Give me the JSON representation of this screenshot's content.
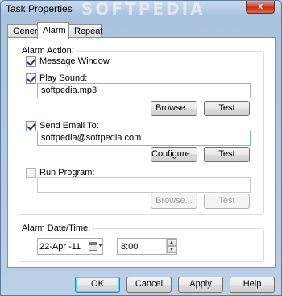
{
  "window": {
    "title": "Task Properties",
    "watermark": "SOFTPEDIA",
    "close_glyph": "x"
  },
  "tabs": [
    {
      "label": "General",
      "active": false
    },
    {
      "label": "Alarm",
      "active": true
    },
    {
      "label": "Repeat",
      "active": false
    }
  ],
  "alarm_action": {
    "group_title": "Alarm Action:",
    "message_window": {
      "label": "Message Window",
      "checked": true
    },
    "play_sound": {
      "label": "Play Sound:",
      "checked": true,
      "value": "softpedia.mp3",
      "browse_label": "Browse...",
      "test_label": "Test"
    },
    "send_email": {
      "label": "Send Email To:",
      "checked": true,
      "value": "softpedia@softpedia.com",
      "configure_label": "Configure...",
      "test_label": "Test"
    },
    "run_program": {
      "label": "Run Program:",
      "checked": false,
      "value": "",
      "browse_label": "Browse...",
      "test_label": "Test"
    }
  },
  "alarm_datetime": {
    "group_title": "Alarm Date/Time:",
    "date": "22-Apr -11",
    "time": "8:00",
    "calendar_icon": "calendar-icon",
    "spin_up": "▲",
    "spin_down": "▼",
    "dropdown_glyph": "▼"
  },
  "footer": {
    "ok_label": "OK",
    "cancel_label": "Cancel",
    "apply_label": "Apply",
    "help_label": "Help"
  }
}
